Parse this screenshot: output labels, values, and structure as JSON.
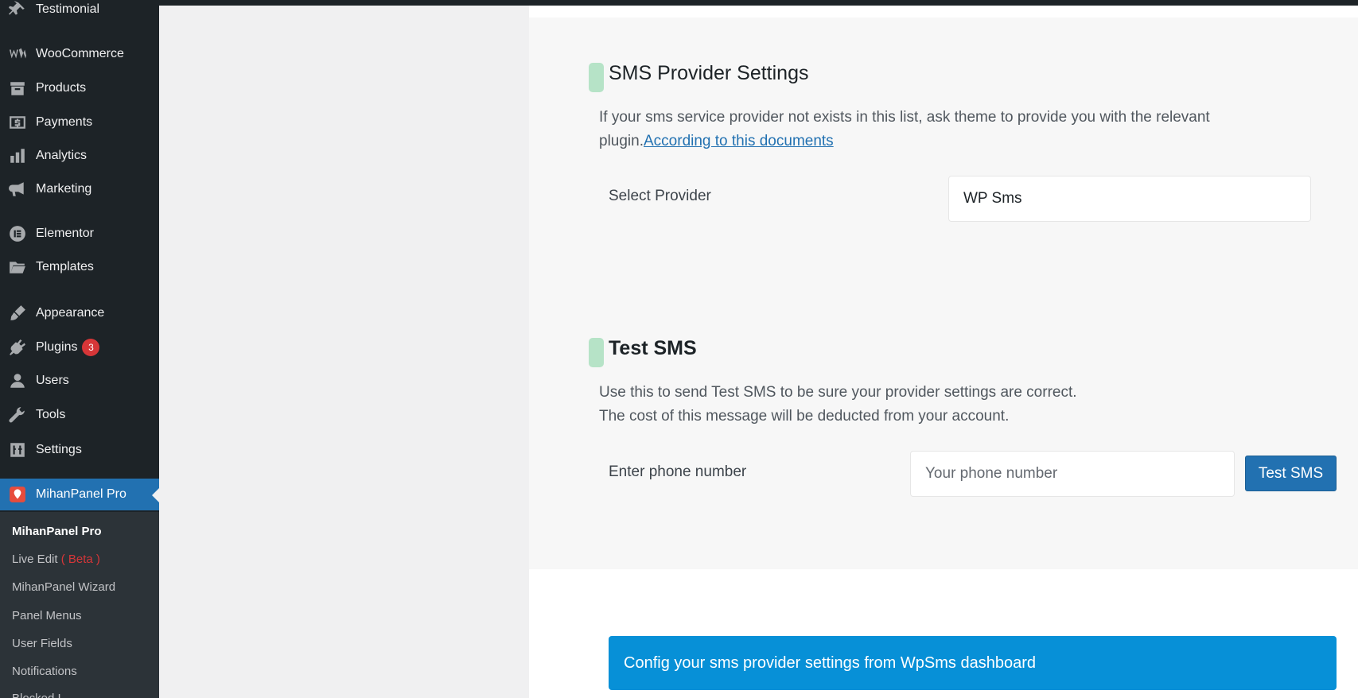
{
  "sidebar": {
    "items": [
      {
        "label": "Testimonial",
        "icon": "pin-icon"
      },
      {
        "label": "WooCommerce",
        "icon": "woocommerce-icon"
      },
      {
        "label": "Products",
        "icon": "archive-icon"
      },
      {
        "label": "Payments",
        "icon": "dollar-icon"
      },
      {
        "label": "Analytics",
        "icon": "bar-chart-icon"
      },
      {
        "label": "Marketing",
        "icon": "megaphone-icon"
      },
      {
        "label": "Elementor",
        "icon": "elementor-icon"
      },
      {
        "label": "Templates",
        "icon": "folder-icon"
      },
      {
        "label": "Appearance",
        "icon": "brush-icon"
      },
      {
        "label": "Plugins",
        "icon": "plug-icon",
        "badge": "3"
      },
      {
        "label": "Users",
        "icon": "user-icon"
      },
      {
        "label": "Tools",
        "icon": "wrench-icon"
      },
      {
        "label": "Settings",
        "icon": "sliders-icon"
      },
      {
        "label": "MihanPanel Pro",
        "icon": "mihanpanel-icon",
        "active": true
      }
    ],
    "submenu": [
      {
        "label": "MihanPanel Pro"
      },
      {
        "label": "Live Edit",
        "suffix": "( Beta )"
      },
      {
        "label": "MihanPanel Wizard"
      },
      {
        "label": "Panel Menus"
      },
      {
        "label": "User Fields"
      },
      {
        "label": "Notifications"
      },
      {
        "label": "Blocked I..."
      }
    ]
  },
  "sms_provider": {
    "title": "SMS Provider Settings",
    "description_prefix": "If your sms service provider not exists in this list, ask theme to provide you with the relevant plugin.",
    "description_link": "According to this documents",
    "select_label": "Select Provider",
    "selected_value": "WP Sms"
  },
  "test_sms": {
    "title": "Test SMS",
    "description_line1": "Use this to send Test SMS to be sure your provider settings are correct.",
    "description_line2": "The cost of this message will be deducted from your account.",
    "phone_label": "Enter phone number",
    "phone_placeholder": "Your phone number",
    "button_label": "Test SMS"
  },
  "notice": {
    "text": "Config your sms provider settings from WpSms dashboard"
  },
  "colors": {
    "sidebar_bg": "#1d2327",
    "active_menu": "#2271b1",
    "section_marker": "#b6e3c7",
    "notice_bg": "#0790d7",
    "badge": "#d63638"
  }
}
